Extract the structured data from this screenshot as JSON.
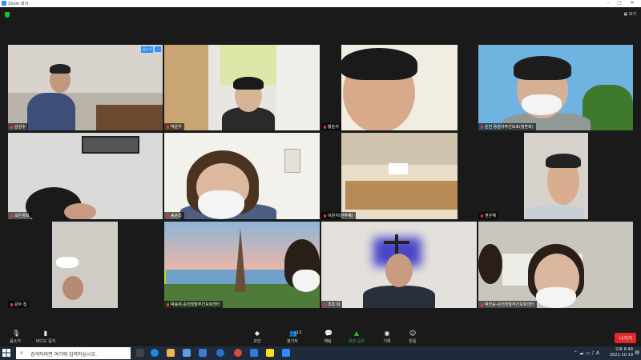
{
  "window": {
    "title": "Zoom 회의",
    "view_label": "보기"
  },
  "tiles": [
    {
      "name": "김성수",
      "badge": "음소거"
    },
    {
      "name": "박윤우"
    },
    {
      "name": "황윤지"
    },
    {
      "name": "순천 동말아주간보호(정혼화)"
    },
    {
      "name": "모든영희"
    },
    {
      "name": "송순조"
    },
    {
      "name": "이문지(원주혜)"
    },
    {
      "name": "권은혜"
    },
    {
      "name": "강수 집"
    },
    {
      "name": "박송희-순천힐말주간보호센터"
    },
    {
      "name": "조조 목"
    },
    {
      "name": "박안숭-순천힐말주간보호센터"
    }
  ],
  "toolbar": {
    "mute": "음소거",
    "video": "비디오 중지",
    "security": "보안",
    "participants": "참가자",
    "participants_count": "13",
    "chat": "채팅",
    "share": "화면 공유",
    "record": "기록",
    "reactions": "반응",
    "leave": "나가기"
  },
  "taskbar": {
    "search_placeholder": "검색하려면 여기에 입력하십시오.",
    "time": "오후 6:49",
    "date": "2021-10-19",
    "lang": "A"
  },
  "colors": {
    "active_speaker": "#b5e02a",
    "leave": "#e02828",
    "share": "#1fbf2a"
  }
}
